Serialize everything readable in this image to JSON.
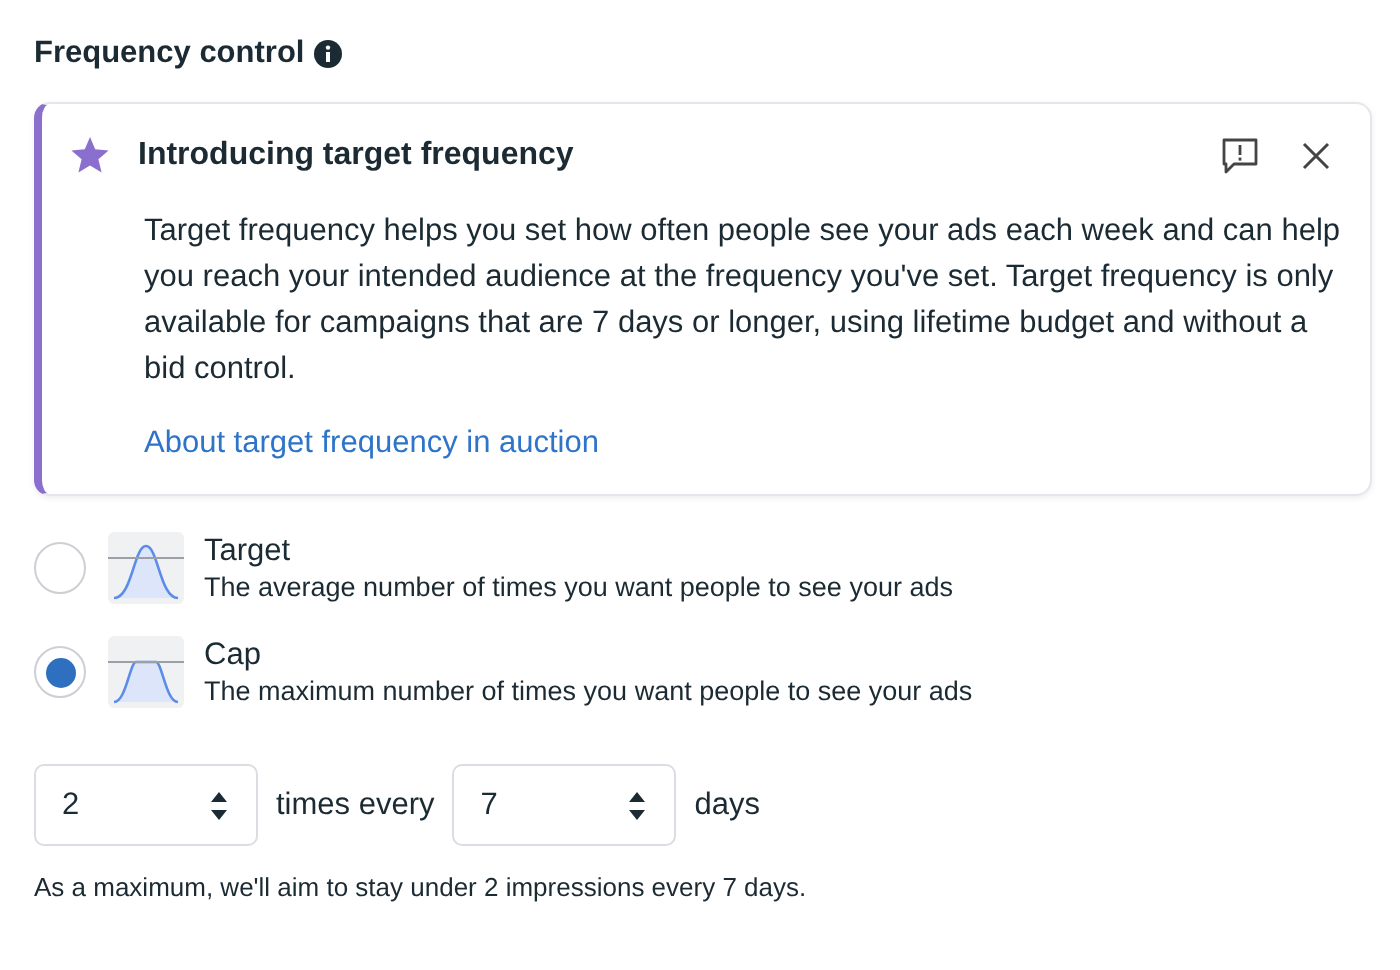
{
  "section": {
    "title": "Frequency control"
  },
  "notice": {
    "title": "Introducing target frequency",
    "body": "Target frequency helps you set how often people see your ads each week and can help you reach your intended audience at the frequency you've set. Target frequency is only available for campaigns that are 7 days or longer, using lifetime budget and without a bid control.",
    "link": "About target frequency in auction"
  },
  "options": [
    {
      "kind": "bell",
      "label": "Target",
      "description": "The average number of times you want people to see your ads",
      "selected": false
    },
    {
      "kind": "plateau",
      "label": "Cap",
      "description": "The maximum number of times you want people to see your ads",
      "selected": true
    }
  ],
  "frequency": {
    "times": "2",
    "between": "times every",
    "days": "7",
    "unit": "days"
  },
  "summary": "As a maximum, we'll aim to stay under 2 impressions every 7 days."
}
